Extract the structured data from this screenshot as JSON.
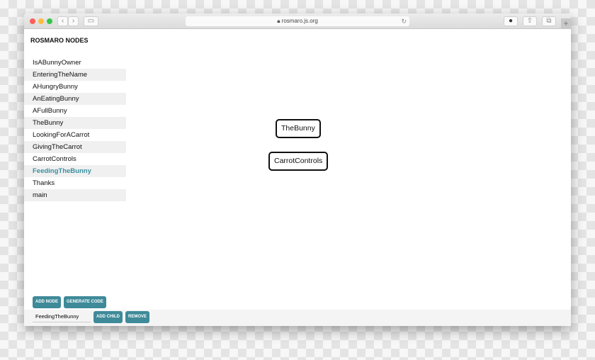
{
  "browser": {
    "url": "rosmaro.js.org",
    "back": "‹",
    "forward": "›",
    "new_tab": "+"
  },
  "sidebar": {
    "title": "ROSMARO NODES",
    "items": [
      "IsABunnyOwner",
      "EnteringTheName",
      "AHungryBunny",
      "AnEatingBunny",
      "AFullBunny",
      "TheBunny",
      "LookingForACarrot",
      "GivingTheCarrot",
      "CarrotControls",
      "FeedingTheBunny",
      "Thanks",
      "main"
    ],
    "active": "FeedingTheBunny"
  },
  "canvas": {
    "nodes": [
      "TheBunny",
      "CarrotControls"
    ]
  },
  "controls": {
    "add_node": "ADD NODE",
    "generate_code": "GENERATE CODE",
    "node_name_value": "FeedingTheBunny",
    "add_child": "ADD CHILD",
    "remove": "REMOVE"
  },
  "colors": {
    "accent": "#3e8a99",
    "active_text": "#3a8fa0"
  }
}
